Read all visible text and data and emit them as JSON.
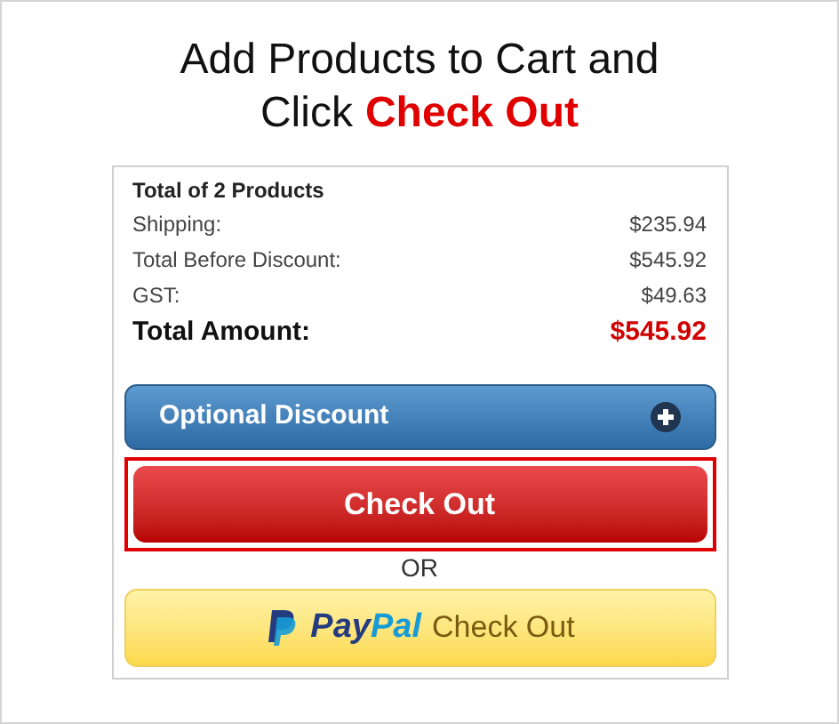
{
  "heading": {
    "line_1": "Add Products to Cart and",
    "line_2_prefix": "Click",
    "line_2_highlight": "Check Out"
  },
  "summary": {
    "title": "Total of 2 Products",
    "rows": [
      {
        "label": "Shipping:",
        "value": "$235.94"
      },
      {
        "label": "Total Before Discount:",
        "value": "$545.92"
      },
      {
        "label": "GST:",
        "value": "$49.63"
      }
    ],
    "total": {
      "label": "Total Amount:",
      "value": "$545.92"
    }
  },
  "discount": {
    "label": "Optional Discount",
    "expanded": false
  },
  "checkout": {
    "label": "Check Out",
    "highlighted": true
  },
  "separator": "OR",
  "paypal": {
    "logo_part_1": "Pay",
    "logo_part_2": "Pal",
    "label": "Check Out"
  }
}
